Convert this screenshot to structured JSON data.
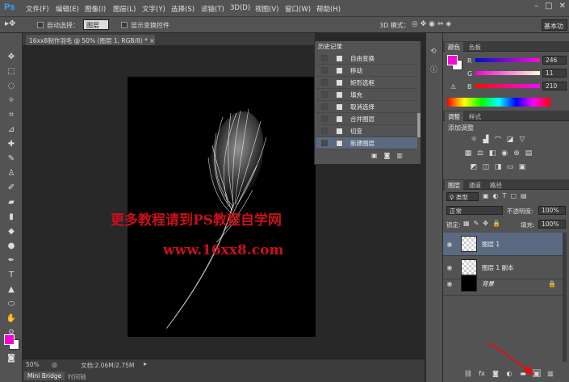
{
  "app": {
    "logo": "Ps"
  },
  "menu": [
    "文件(F)",
    "编辑(E)",
    "图像(I)",
    "图层(L)",
    "文字(Y)",
    "选择(S)",
    "滤镜(T)",
    "3D(D)",
    "视图(V)",
    "窗口(W)",
    "帮助(H)"
  ],
  "options": {
    "auto_select_label": "自动选择：",
    "auto_select_value": "图层",
    "show_transform_label": "显示变换控件",
    "mode_3d_label": "3D 模式：",
    "workspace": "基本功"
  },
  "document": {
    "tab_title": "16xx8制作羽毛 @ 50% (图层 1, RGB/8) *",
    "zoom": "50%",
    "doc_size": "文档:2.06M/2.75M"
  },
  "watermark": {
    "line1": "更多教程请到PS教程自学网",
    "line2": "www.16xx8.com"
  },
  "bottom_tabs": [
    "Mini Bridge",
    "时间轴"
  ],
  "history": {
    "title": "历史记录",
    "items": [
      "自由变换",
      "移动",
      "矩形选框",
      "填充",
      "取消选择",
      "合并图层",
      "切变",
      "新建图层"
    ],
    "selected_index": 7
  },
  "color_panel": {
    "tabs": [
      "颜色",
      "色板"
    ],
    "r": "246",
    "g": "11",
    "b": "210",
    "fg_color": "#f60bd2"
  },
  "adjustments": {
    "tabs": [
      "调整",
      "样式"
    ],
    "title": "添加调整"
  },
  "layers_panel": {
    "tabs": [
      "图层",
      "通道",
      "路径"
    ],
    "filter": "类型",
    "blend_mode": "正常",
    "opacity_label": "不透明度:",
    "opacity": "100%",
    "lock_label": "锁定:",
    "fill_label": "填充:",
    "fill": "100%",
    "layers": [
      {
        "name": "图层 1",
        "selected": true,
        "thumb": "transparent"
      },
      {
        "name": "图层 1 副本",
        "selected": false,
        "thumb": "transparent"
      },
      {
        "name": "背景",
        "selected": false,
        "thumb": "black",
        "locked": true
      }
    ]
  },
  "colors": {
    "accent": "#f600d2",
    "selection": "#5a6a82",
    "watermark": "#c8101a",
    "arrow": "#e01010"
  }
}
